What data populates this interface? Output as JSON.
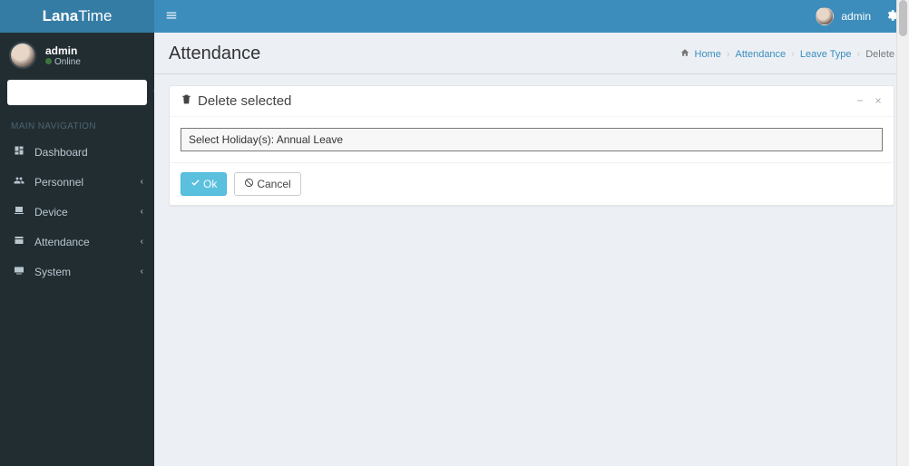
{
  "brand": {
    "prefix": "Lana",
    "suffix": "Time"
  },
  "sidebar": {
    "user": {
      "name": "admin",
      "status": "Online"
    },
    "header": "MAIN NAVIGATION",
    "items": [
      {
        "icon": "dashboard",
        "label": "Dashboard",
        "expandable": false
      },
      {
        "icon": "users",
        "label": "Personnel",
        "expandable": true
      },
      {
        "icon": "device",
        "label": "Device",
        "expandable": true
      },
      {
        "icon": "attendance",
        "label": "Attendance",
        "expandable": true
      },
      {
        "icon": "system",
        "label": "System",
        "expandable": true
      }
    ]
  },
  "topbar": {
    "user_name": "admin"
  },
  "page": {
    "title": "Attendance",
    "breadcrumb": {
      "home": "Home",
      "attendance": "Attendance",
      "leave_type": "Leave Type",
      "current": "Delete"
    }
  },
  "panel": {
    "title": "Delete selected",
    "body_text": "Select Holiday(s): Annual Leave",
    "ok_label": "Ok",
    "cancel_label": "Cancel"
  }
}
